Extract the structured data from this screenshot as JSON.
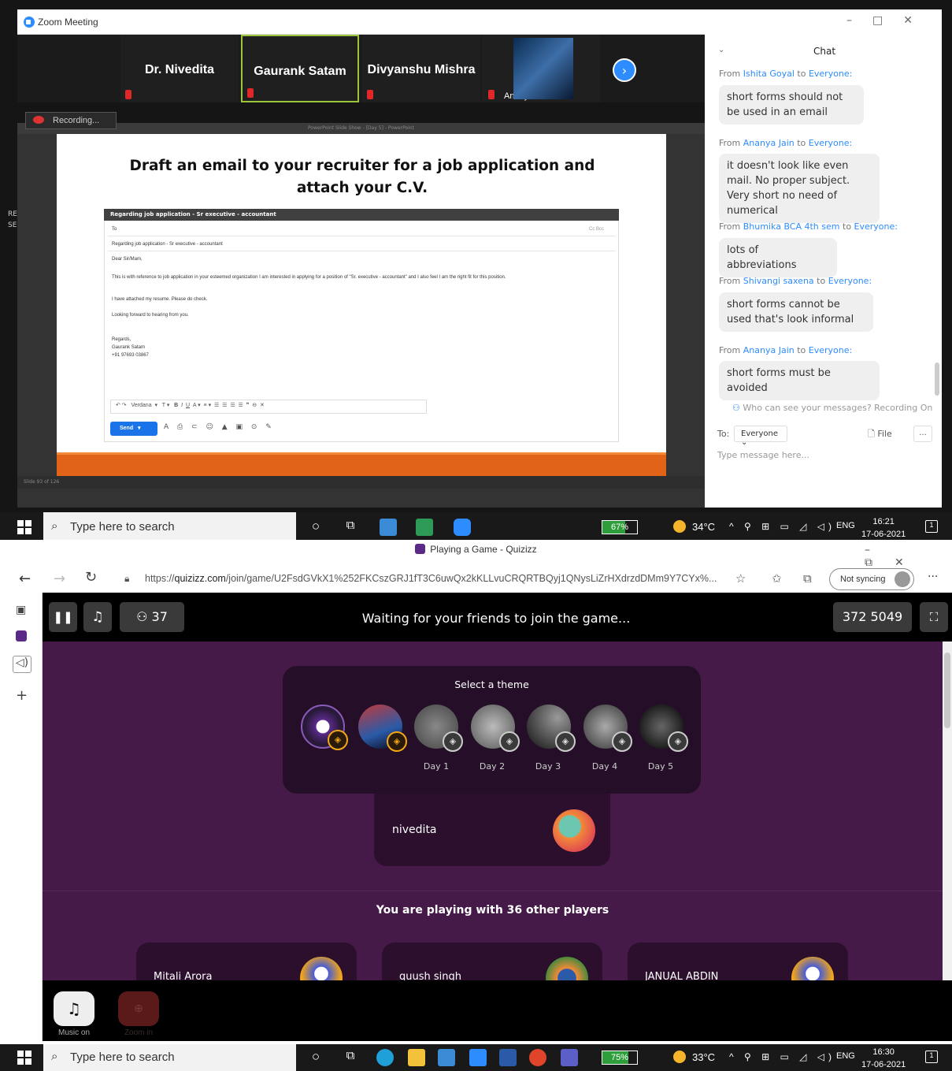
{
  "zoom": {
    "window_title": "Zoom Meeting",
    "participants": [
      {
        "name": "Dr. Nivedita"
      },
      {
        "name": "Gaurank Satam"
      },
      {
        "name": "Divyanshu Mishra"
      },
      {
        "name": "Ananya Jain"
      }
    ],
    "recording_label": "Recording...",
    "slide": {
      "window_title": "PowerPoint Slide Show - [Day 5] - PowerPoint",
      "heading": "Draft an email to your recruiter for a job application and attach your C.V.",
      "status": "Slide 93 of 126",
      "email": {
        "window_title": "Regarding job application - Sr executive - accountant",
        "to_label": "To",
        "cc_label": "Cc Bcc",
        "subject": "Regarding job application - Sr executive - accountant",
        "greeting": "Dear Sir/Mam,",
        "body1": "This is with reference to job application in your esteemed organization I am interested in applying for a position of \"Sr. executive - accountant\" and I also feel I am the right fit for this position.",
        "body2": "I have attached my resume. Please do check.",
        "body3": "Looking forward to hearing from you.",
        "sign1": "Regards,",
        "sign2": "Gaurank Satam",
        "sign3": "+91 97693 03867",
        "font_name": "Verdana",
        "send_label": "Send"
      }
    },
    "chat": {
      "title": "Chat",
      "messages": [
        {
          "from_prefix": "From",
          "from": "Ishita Goyal",
          "to_word": "to",
          "to": "Everyone:",
          "text": "short forms should not be used in an email"
        },
        {
          "from_prefix": "From",
          "from": "Ananya Jain",
          "to_word": "to",
          "to": "Everyone:",
          "text": "it doesn't look like even mail. No proper subject. Very short no need of numerical"
        },
        {
          "from_prefix": "From",
          "from": "Bhumika BCA 4th sem",
          "to_word": "to",
          "to": "Everyone:",
          "text": "lots of abbreviations"
        },
        {
          "from_prefix": "From",
          "from": "Shivangi saxena",
          "to_word": "to",
          "to": "Everyone:",
          "text": "short forms cannot be used that's look informal"
        },
        {
          "from_prefix": "From",
          "from": "Ananya Jain",
          "to_word": "to",
          "to": "Everyone:",
          "text": "short forms must be avoided"
        }
      ],
      "who_can_see": "Who can see your messages? Recording On",
      "to_label": "To:",
      "to_value": "Everyone",
      "file_label": "File",
      "more_label": "...",
      "input_placeholder": "Type message here..."
    }
  },
  "taskbar1": {
    "search_placeholder": "Type here to search",
    "battery": "67%",
    "battery_level": 0.67,
    "temperature": "34°C",
    "lang": "ENG",
    "time": "16:21",
    "date": "17-06-2021"
  },
  "browser": {
    "tab_title": "Playing a Game - Quizizz",
    "url_prefix": "https://",
    "url_domain": "quizizz.com",
    "url_rest": "/join/game/U2FsdGVkX1%252FKCszGRJ1fT3C6uwQx2kKLLvuCRQRTBQyj1QNysLiZrHXdrzdDMm9Y7CYx%...",
    "sync_label": "Not syncing",
    "quiz": {
      "player_count": "37",
      "waiting_text": "Waiting for your friends to join the game...",
      "game_code": "372 5049",
      "theme_label": "Select a theme",
      "days": [
        "Day 1",
        "Day 2",
        "Day 3",
        "Day 4",
        "Day 5"
      ],
      "player_name": "nivedita",
      "playing_with": "You are playing with 36 other players",
      "others": [
        "Mitali Arora",
        "quush singh",
        "JANUAL ABDIN"
      ],
      "music_label": "Music on",
      "zoom_label": "Zoom in"
    }
  },
  "taskbar2": {
    "search_placeholder": "Type here to search",
    "battery": "75%",
    "battery_level": 0.75,
    "temperature": "33°C",
    "lang": "ENG",
    "time": "16:30",
    "date": "17-06-2021"
  }
}
